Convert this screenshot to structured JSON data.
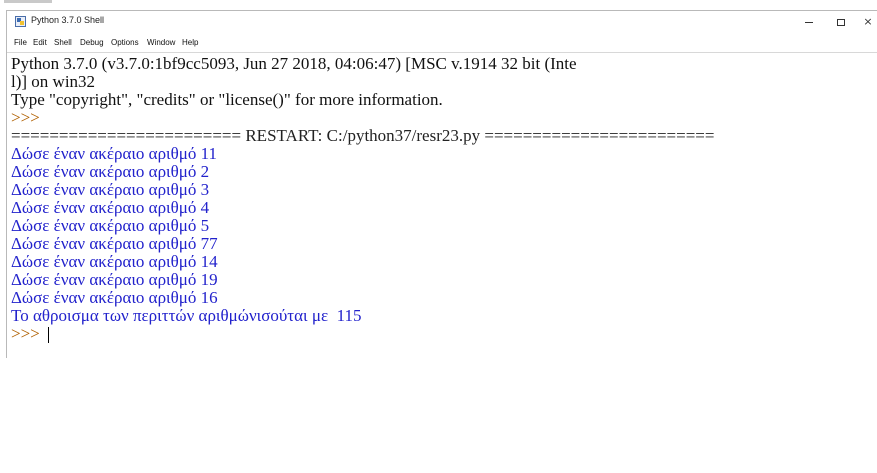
{
  "window": {
    "title": "Python 3.7.0 Shell",
    "controls": {
      "minimize": "–",
      "maximize": "□",
      "close": "×"
    }
  },
  "menu": [
    "File",
    "Edit",
    "Shell",
    "Debug",
    "Options",
    "Window",
    "Help"
  ],
  "shell": {
    "banner_1": "Python 3.7.0 (v3.7.0:1bf9cc5093, Jun 27 2018, 04:06:47) [MSC v.1914 32 bit (Inte",
    "banner_2": "l)] on win32",
    "banner_3": "Type \"copyright\", \"credits\" or \"license()\" for more information.",
    "prompt_1": ">>>",
    "restart": "======================== RESTART: C:/python37/resr23.py ========================",
    "inputs": [
      "Δώσε έναν ακέραιο αριθμό 11",
      "Δώσε έναν ακέραιο αριθμό 2",
      "Δώσε έναν ακέραιο αριθμό 3",
      "Δώσε έναν ακέραιο αριθμό 4",
      "Δώσε έναν ακέραιο αριθμό 5",
      "Δώσε έναν ακέραιο αριθμό 77",
      "Δώσε έναν ακέραιο αριθμό 14",
      "Δώσε έναν ακέραιο αριθμό 19",
      "Δώσε έναν ακέραιο αριθμό 16"
    ],
    "result": "Το αθροισμα των περιττών αριθμώνισούται με  115",
    "prompt_2": ">>> "
  },
  "colors": {
    "prompt": "#b06000",
    "output": "#2222cc",
    "text": "#111111"
  },
  "icons": {
    "app": "python-idle-icon"
  }
}
